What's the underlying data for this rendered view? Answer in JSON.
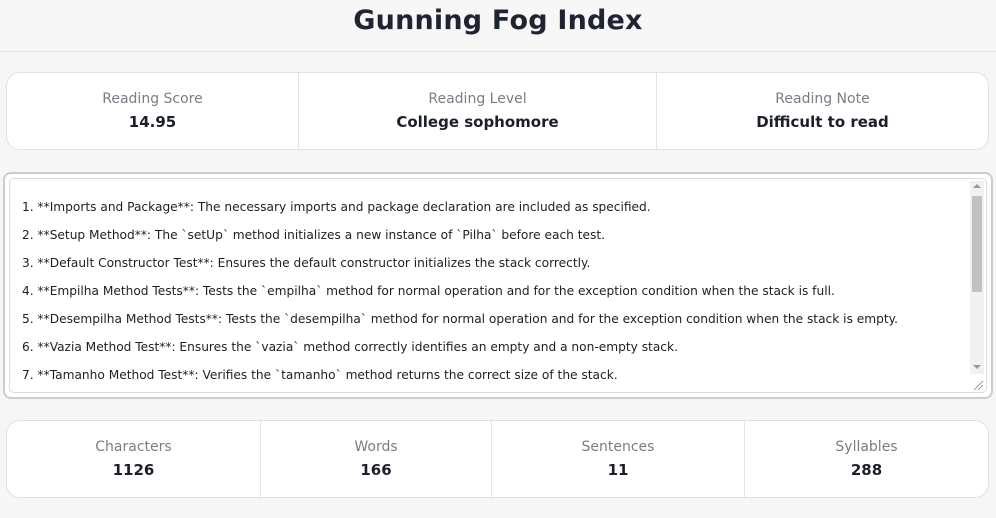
{
  "header": {
    "title": "Gunning Fog Index"
  },
  "reading": [
    {
      "label": "Reading Score",
      "value": "14.95"
    },
    {
      "label": "Reading Level",
      "value": "College sophomore"
    },
    {
      "label": "Reading Note",
      "value": "Difficult to read"
    }
  ],
  "input": {
    "lines": [
      "1. **Imports and Package**: The necessary imports and package declaration are included as specified.",
      "2. **Setup Method**: The `setUp` method initializes a new instance of `Pilha` before each test.",
      "3. **Default Constructor Test**: Ensures the default constructor initializes the stack correctly.",
      "4. **Empilha Method Tests**: Tests the `empilha` method for normal operation and for the exception condition when the stack is full.",
      "5. **Desempilha Method Tests**: Tests the `desempilha` method for normal operation and for the exception condition when the stack is empty.",
      "6. **Vazia Method Test**: Ensures the `vazia` method correctly identifies an empty and a non-empty stack.",
      "7. **Tamanho Method Test**: Verifies the `tamanho` method returns the correct size of the stack."
    ],
    "scroll_fraction": 0.0
  },
  "counts": [
    {
      "label": "Characters",
      "value": "1126"
    },
    {
      "label": "Words",
      "value": "166"
    },
    {
      "label": "Sentences",
      "value": "11"
    },
    {
      "label": "Syllables",
      "value": "288"
    }
  ],
  "icons": {
    "scroll_up": "scroll-up-arrow-icon",
    "scroll_down": "scroll-down-arrow-icon",
    "resize": "resize-grip-icon"
  }
}
